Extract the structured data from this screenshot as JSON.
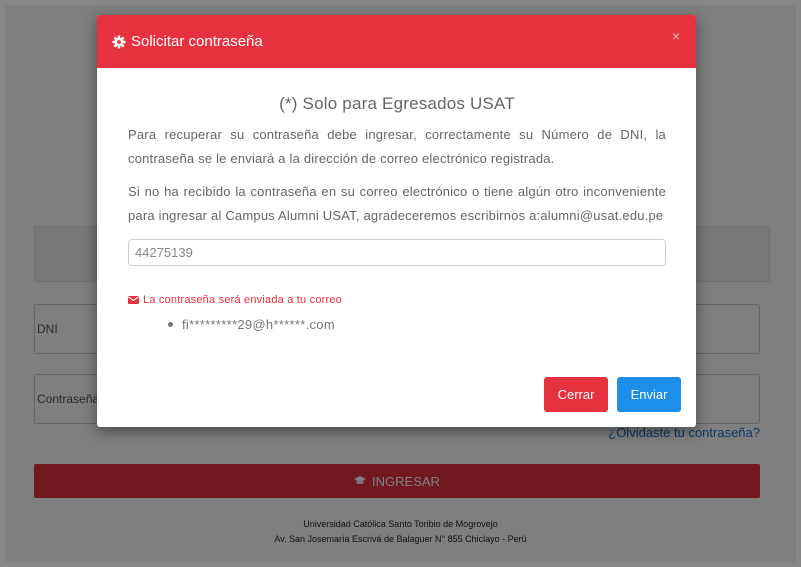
{
  "background": {
    "dni_placeholder": "DNI",
    "password_placeholder": "Contraseña",
    "forgot_link": "¿Olvidaste tu contraseña?",
    "login_button": "INGRESAR",
    "footer_line1": "Universidad Católica Santo Toribio de Mogrovejo",
    "footer_line2": "Av. San Josemaría Escrivá de Balaguer N° 855 Chiclayo - Perú"
  },
  "modal": {
    "title": "Solicitar contraseña",
    "close_symbol": "×",
    "notice": "(*) Solo para Egresados USAT",
    "paragraph1": "Para recuperar su contraseña debe ingresar, correctamente su Número de DNI, la contraseña se le enviará a la dirección de correo electrónico registrada.",
    "paragraph2": "Si no ha recibido la contraseña en su correo electrónico o tiene algún otro inconveniente para ingresar al Campus Alumni USAT, agradeceremos escribirnos a:alumni@usat.edu.pe",
    "dni_value": "44275139",
    "mail_note": "La contraseña será enviada a tu correo",
    "masked_email": "fi*********29@h******.com",
    "close_button": "Cerrar",
    "send_button": "Enviar"
  },
  "colors": {
    "accent_red": "#e5323e",
    "primary_blue": "#1e8fe8"
  },
  "icons": [
    "gear-icon",
    "close-icon",
    "envelope-icon",
    "graduation-cap-icon"
  ]
}
